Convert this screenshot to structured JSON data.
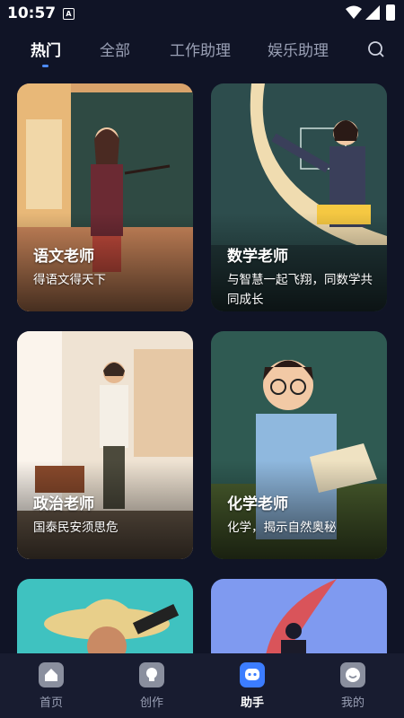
{
  "status": {
    "time": "10:57",
    "notif_icon": "A"
  },
  "tabs": [
    {
      "label": "热门",
      "active": true
    },
    {
      "label": "全部"
    },
    {
      "label": "工作助理"
    },
    {
      "label": "娱乐助理"
    }
  ],
  "cards": [
    {
      "title": "语文老师",
      "desc": "得语文得天下"
    },
    {
      "title": "数学老师",
      "desc": "与智慧一起飞翔，同数学共同成长"
    },
    {
      "title": "政治老师",
      "desc": "国泰民安须思危"
    },
    {
      "title": "化学老师",
      "desc": "化学，揭示自然奥秘"
    }
  ],
  "nav": [
    {
      "label": "首页",
      "icon": "home-icon"
    },
    {
      "label": "创作",
      "icon": "create-icon"
    },
    {
      "label": "助手",
      "icon": "assistant-icon",
      "active": true
    },
    {
      "label": "我的",
      "icon": "profile-icon"
    }
  ],
  "colors": {
    "background": "#101426",
    "accent": "#3c7dff",
    "nav_bg": "#181c30"
  }
}
